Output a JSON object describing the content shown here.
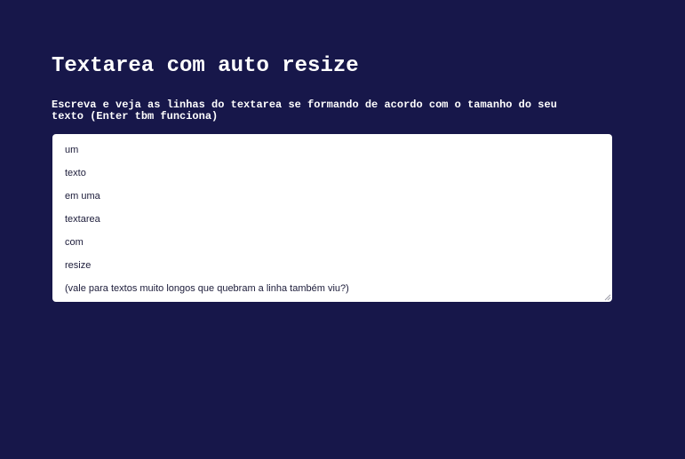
{
  "page": {
    "title": "Textarea com auto resize",
    "instructions": "Escreva e veja as linhas do textarea se formando de acordo com o tamanho do seu texto (Enter tbm funciona)"
  },
  "textarea": {
    "lines": [
      "um",
      "texto",
      "em uma",
      "textarea",
      "com",
      "resize",
      "(vale para textos muito longos que quebram a linha também viu?)"
    ]
  },
  "colors": {
    "background": "#17174a",
    "text": "#ffffff",
    "textarea_bg": "#ffffff",
    "textarea_text": "#1c1c3a"
  },
  "icons": {
    "resize": "resize-grip-icon"
  }
}
